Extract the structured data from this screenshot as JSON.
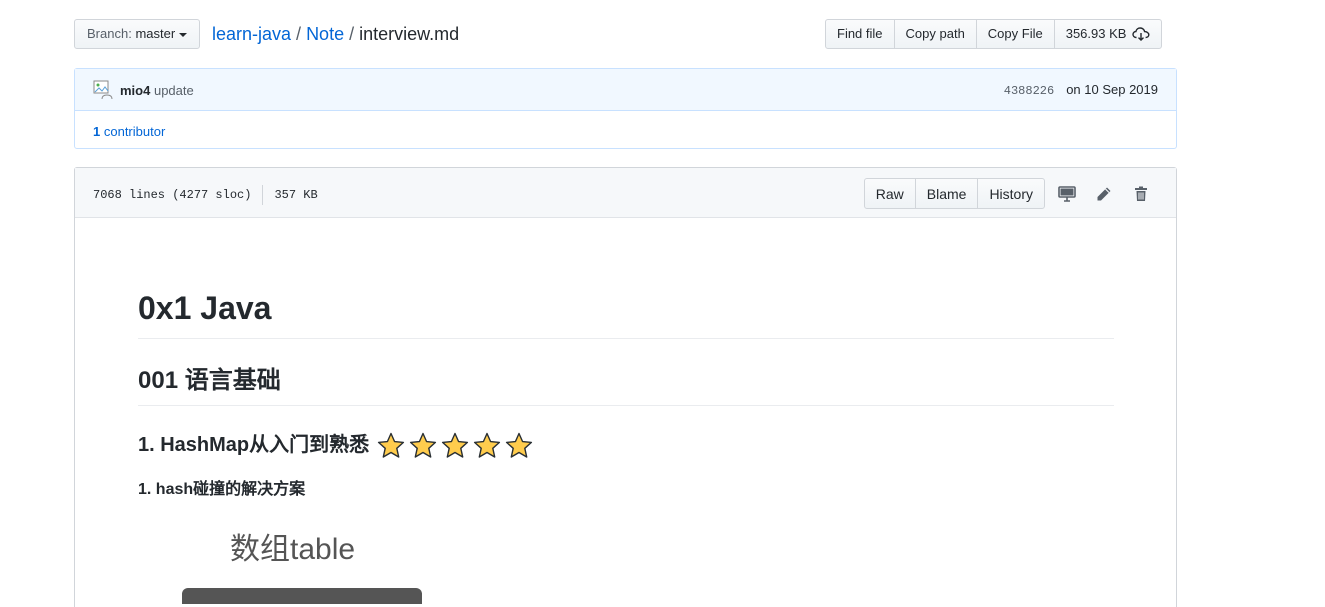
{
  "file_nav": {
    "branch_prefix": "Branch:",
    "branch_name": "master",
    "breadcrumb": {
      "repo": "learn-java",
      "folder": "Note",
      "file": "interview.md",
      "separator": "/"
    },
    "buttons": {
      "find_file": "Find file",
      "copy_path": "Copy path",
      "copy_file": "Copy File",
      "size": "356.93 KB"
    },
    "size_icon": "cloud-download-icon"
  },
  "commit": {
    "author": "mio4",
    "message": "update",
    "sha": "4388226",
    "date": "on 10 Sep 2019",
    "contributors_count": "1",
    "contributors_label": "contributor"
  },
  "file_header": {
    "lines": "7068 lines (4277 sloc)",
    "size": "357 KB",
    "buttons": {
      "raw": "Raw",
      "blame": "Blame",
      "history": "History"
    },
    "icons": [
      "desktop-icon",
      "pencil-icon",
      "trash-icon"
    ]
  },
  "markdown": {
    "h1": "0x1 Java",
    "h2": "001 语言基础",
    "h3": "1. HashMap从入门到熟悉",
    "h3_stars": 5,
    "h4": "1. hash碰撞的解决方案",
    "figure_label": "数组table"
  },
  "colors": {
    "link": "#0366d6",
    "commit_bg": "#f1f8ff",
    "star": "#ffcc4d"
  }
}
